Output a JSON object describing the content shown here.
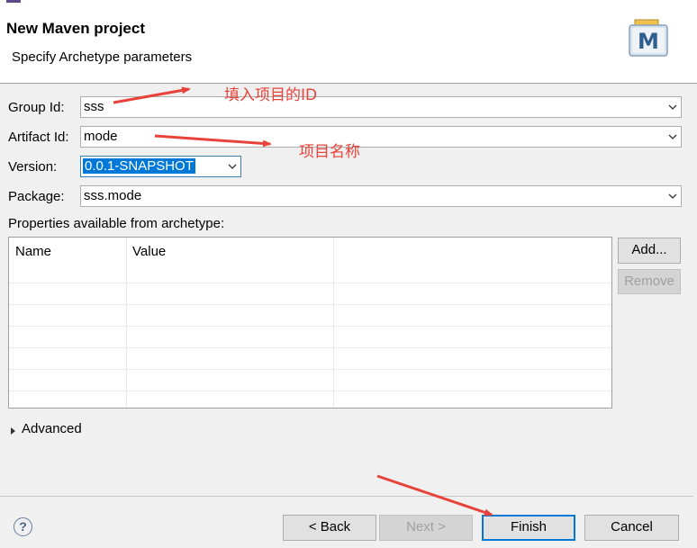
{
  "header": {
    "title": "New Maven project",
    "subtitle": "Specify Archetype parameters",
    "logo_letter": "M"
  },
  "form": {
    "group_id": {
      "label": "Group Id:",
      "value": "sss"
    },
    "artifact_id": {
      "label": "Artifact Id:",
      "value": "mode"
    },
    "version": {
      "label": "Version:",
      "value": "0.0.1-SNAPSHOT"
    },
    "package": {
      "label": "Package:",
      "value": "sss.mode"
    }
  },
  "properties": {
    "label": "Properties available from archetype:",
    "columns": [
      "Name",
      "Value"
    ],
    "add_label": "Add...",
    "remove_label": "Remove"
  },
  "advanced": {
    "label": "Advanced"
  },
  "footer": {
    "help_symbol": "?",
    "back_label": "< Back",
    "next_label": "Next >",
    "finish_label": "Finish",
    "cancel_label": "Cancel"
  },
  "annotations": {
    "group_note": "填入项目的ID",
    "artifact_note": "项目名称"
  },
  "colors": {
    "annotation": "#e8433a",
    "selection": "#0078d7",
    "default_button_border": "#0078d7"
  }
}
